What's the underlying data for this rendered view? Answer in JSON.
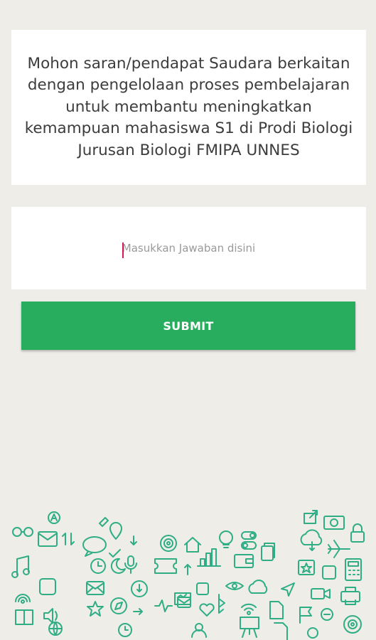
{
  "question": {
    "text": "Mohon saran/pendapat Saudara berkaitan dengan pengelolaan proses pembelajaran untuk membantu meningkatkan kemampuan mahasiswa S1 di Prodi Biologi Jurusan Biologi FMIPA UNNES"
  },
  "answer": {
    "value": "",
    "placeholder": "Masukkan Jawaban disini"
  },
  "submit": {
    "label": "SUBMIT"
  },
  "colors": {
    "background": "#efede8",
    "accent": "#28ad5f",
    "doodle": "#2fae86",
    "cursor": "#d81b60"
  },
  "decoration": {
    "icons": [
      "glasses-icon",
      "mail-icon",
      "transfer-icon",
      "chat-icon",
      "check-icon",
      "bulb-icon",
      "target-icon",
      "home-icon",
      "bar-chart-icon",
      "copy-icon",
      "camera-icon",
      "share-icon",
      "lock-icon",
      "cloud-download-icon",
      "plane-icon",
      "music-icon",
      "tablet-icon",
      "clock-icon",
      "mic-icon",
      "ticket-icon",
      "wallet-icon",
      "calculator-icon",
      "star-icon",
      "heart-icon",
      "compass-icon",
      "book-icon",
      "volume-icon",
      "globe-icon",
      "video-icon",
      "flag-icon",
      "printer-icon",
      "rss-icon",
      "user-icon",
      "presentation-icon"
    ]
  }
}
